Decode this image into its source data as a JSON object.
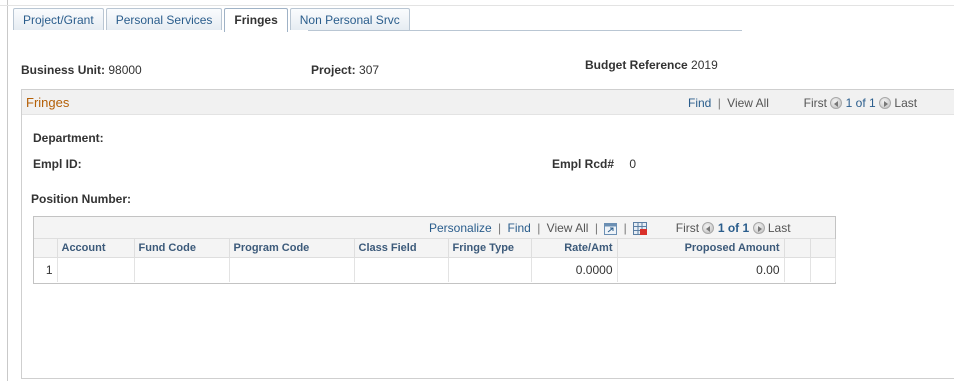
{
  "tabs": [
    {
      "label": "Project/Grant",
      "active": false
    },
    {
      "label": "Personal Services",
      "active": false
    },
    {
      "label": "Fringes",
      "active": true
    },
    {
      "label": "Non Personal Srvc",
      "active": false
    }
  ],
  "header": {
    "business_unit_label": "Business Unit:",
    "business_unit_value": "98000",
    "project_label": "Project:",
    "project_value": "307",
    "budget_ref_label": "Budget Reference",
    "budget_ref_value": "2019"
  },
  "group": {
    "title": "Fringes",
    "find": "Find",
    "divider": "|",
    "view_all": "View All",
    "first": "First",
    "page_info": "1 of 1",
    "last": "Last",
    "department_label": "Department:",
    "empl_id_label": "Empl ID:",
    "empl_rcd_label": "Empl Rcd#",
    "empl_rcd_value": "0",
    "position_label": "Position Number:"
  },
  "grid": {
    "personalize": "Personalize",
    "find": "Find",
    "divider": "|",
    "view_all": "View All",
    "first": "First",
    "page_info": "1 of 1",
    "last": "Last",
    "columns": [
      "",
      "Account",
      "Fund Code",
      "Program Code",
      "Class Field",
      "Fringe Type",
      "Rate/Amt",
      "Proposed Amount",
      "",
      ""
    ],
    "rows": [
      {
        "num": "1",
        "account": "",
        "fund_code": "",
        "program_code": "",
        "class_field": "",
        "fringe_type": "",
        "rate_amt": "0.0000",
        "proposed_amount": "0.00"
      }
    ]
  },
  "colors": {
    "accent_link": "#2a5d8c",
    "group_title": "#b45f06",
    "header_text": "#3c5a7a"
  },
  "icons": [
    "zoom-icon",
    "download-grid-icon",
    "first-arrow-icon",
    "next-arrow-icon"
  ]
}
